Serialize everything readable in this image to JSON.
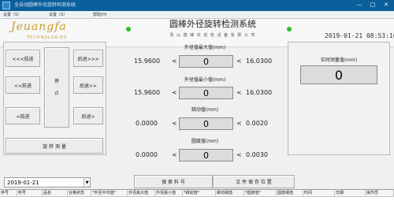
{
  "window": {
    "title": "全自动圆棒外径旋转检测系统"
  },
  "menu": [
    {
      "label": "设置（S）"
    },
    {
      "label": "设置（S）"
    },
    {
      "label": "帮助(H)"
    }
  ],
  "header": {
    "logo_text": "Jeuangfa",
    "logo_sub": "TECHNOLOGIES",
    "main_title": "圆棒外径旋转检测系统",
    "company": "昆 山 捷 峰 实 创 检 设 备 有 限 公 司",
    "datetime": "2019-01-21  08:53:16"
  },
  "controls": {
    "forward_fast": "<<<前进",
    "back_fast": "后退>>>",
    "forward_mid": "<<前进",
    "back_mid": "后退>>",
    "forward_slow": "<前进",
    "back_slow": "后退>",
    "stop_1": "停",
    "stop_2": "止",
    "rotate_measure": "旋 转 测 量"
  },
  "measurements": [
    {
      "label": "外径值最大值(mm)",
      "lower": "15.9600",
      "value": "0",
      "upper": "16.0300",
      "op_left": "<",
      "op_right": "<"
    },
    {
      "label": "外径值最小值(mm)",
      "lower": "15.9600",
      "value": "0",
      "upper": "16.0300",
      "op_left": "<",
      "op_right": "<"
    },
    {
      "label": "跳动值(mm)",
      "lower": "0.0000",
      "value": "0",
      "upper": "0.0020",
      "op_left": "<",
      "op_right": "<"
    },
    {
      "label": "圆度值(mm)",
      "lower": "0.0000",
      "value": "0",
      "upper": "0.0030",
      "op_left": "<",
      "op_right": "<"
    }
  ],
  "realtime": {
    "label": "实时测量值(mm)",
    "value": "0"
  },
  "search": {
    "date": "2019-01-21",
    "search_button": "搜 索 料 号",
    "save_button": "文 件 保 存 位 置"
  },
  "table": {
    "columns": [
      "序号",
      "料号",
      "品名",
      "合格状态",
      "*外径平均值*",
      "外径最大值",
      "外径最小值",
      "*跳动值*",
      "跳动阈值",
      "*圆度值*",
      "圆度阈值",
      "时间",
      "日期",
      "操作员"
    ]
  }
}
